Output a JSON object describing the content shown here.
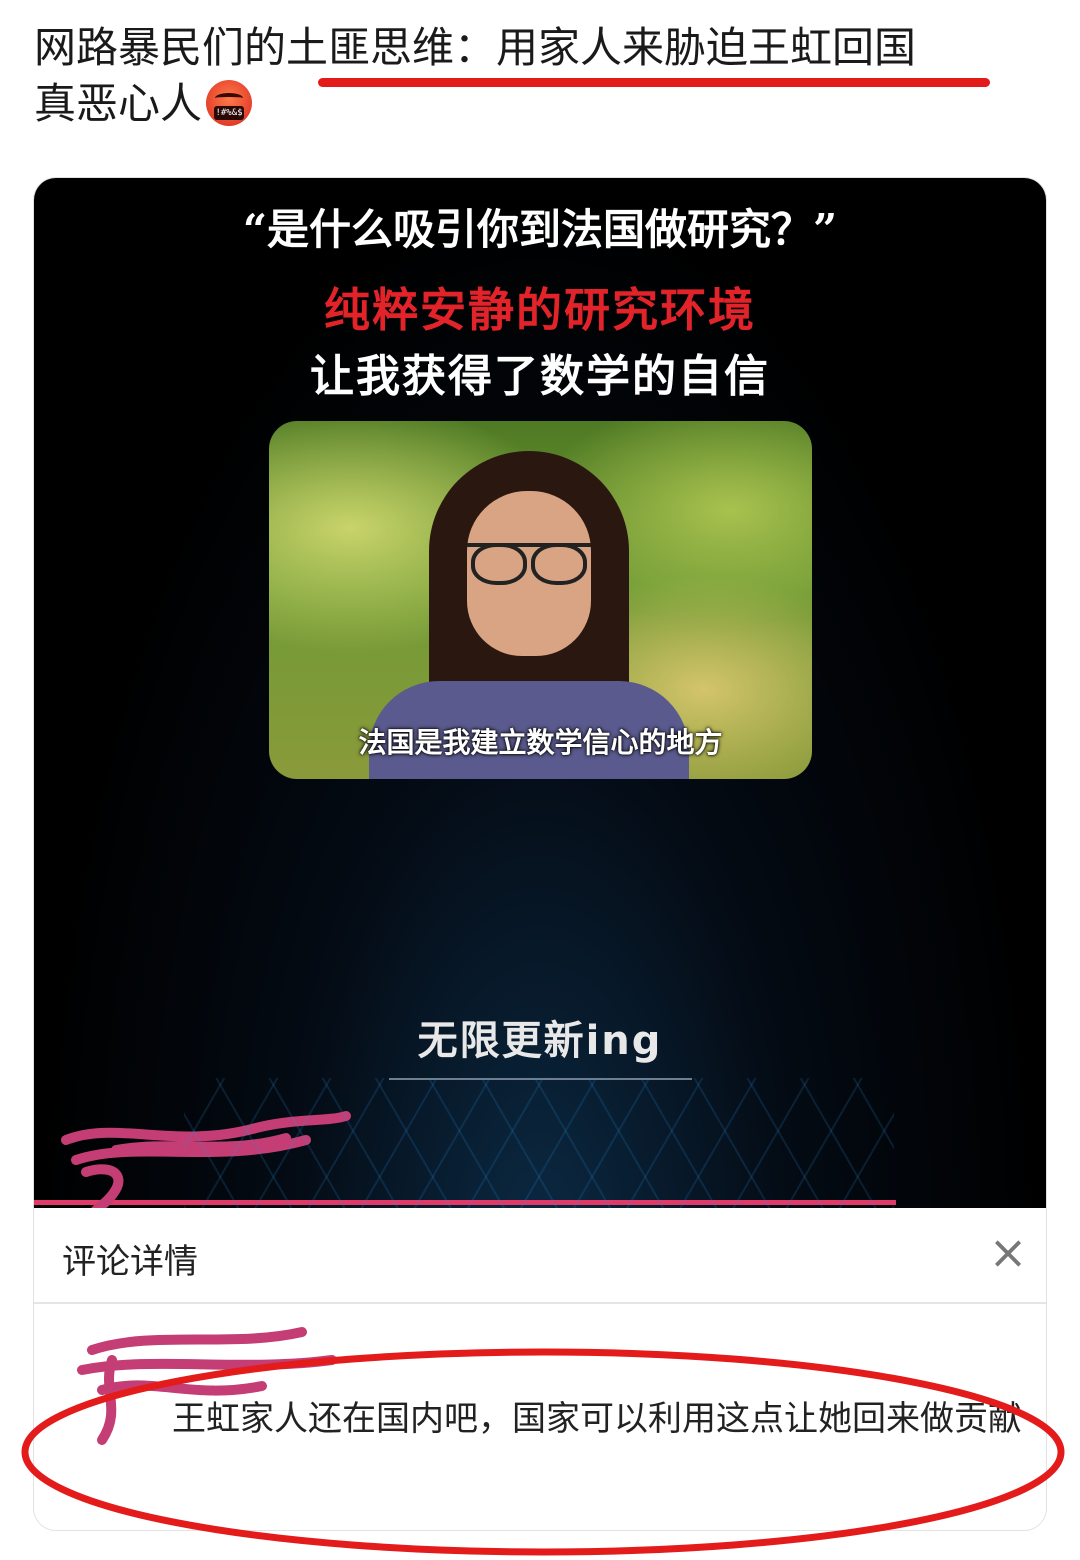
{
  "post": {
    "line1": "网路暴民们的土匪思维：用家人来胁迫王虹回国",
    "line2": "真恶心人",
    "emoji": "angry-cursing-face-icon",
    "emoji_text": "!#%&$"
  },
  "video": {
    "quote": "“是什么吸引你到法国做研究？”",
    "red_text": "纯粹安静的研究环境",
    "white_text": "让我获得了数学的自信",
    "photo_subtitle": "法国是我建立数学信心的地方",
    "banner": "无限更新ing"
  },
  "comment_sheet": {
    "title": "评论详情",
    "close_icon": "×",
    "comment_text": "王虹家人还在国内吧，国家可以利用这点让她回来做贡献"
  },
  "colors": {
    "annotation_red": "#e31b1b",
    "video_red": "#e3232a",
    "scribble_pink": "#c43d74"
  }
}
